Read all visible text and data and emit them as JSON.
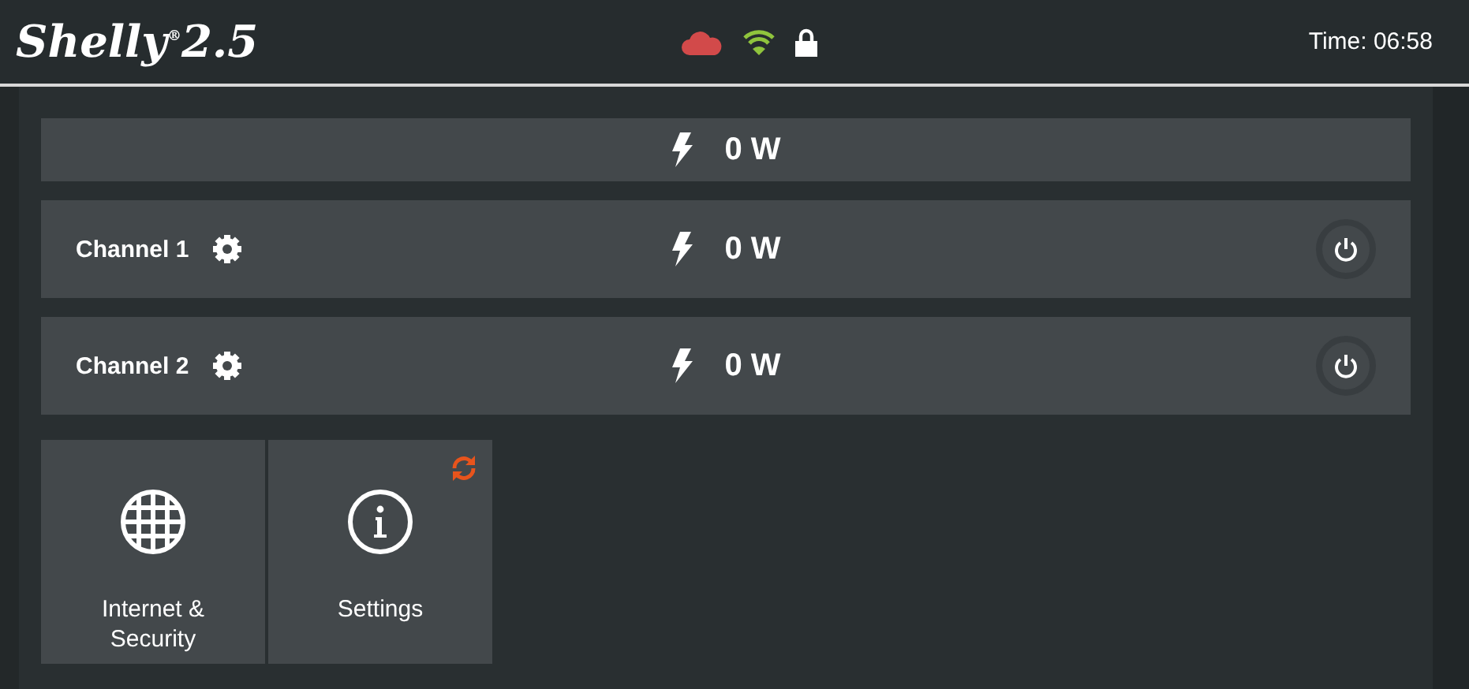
{
  "header": {
    "logo": "Shelly$^{®}$2.5",
    "time": "Time: 06:58"
  },
  "total": {
    "power": "0 W"
  },
  "channels": [
    {
      "name": "Channel 1",
      "power": "0 W"
    },
    {
      "name": "Channel 2",
      "power": "0 W"
    }
  ],
  "tiles": [
    {
      "kind": "globe",
      "label": "Internet & Security",
      "update": false
    },
    {
      "kind": "info",
      "label": "Settings",
      "update": true
    }
  ]
}
